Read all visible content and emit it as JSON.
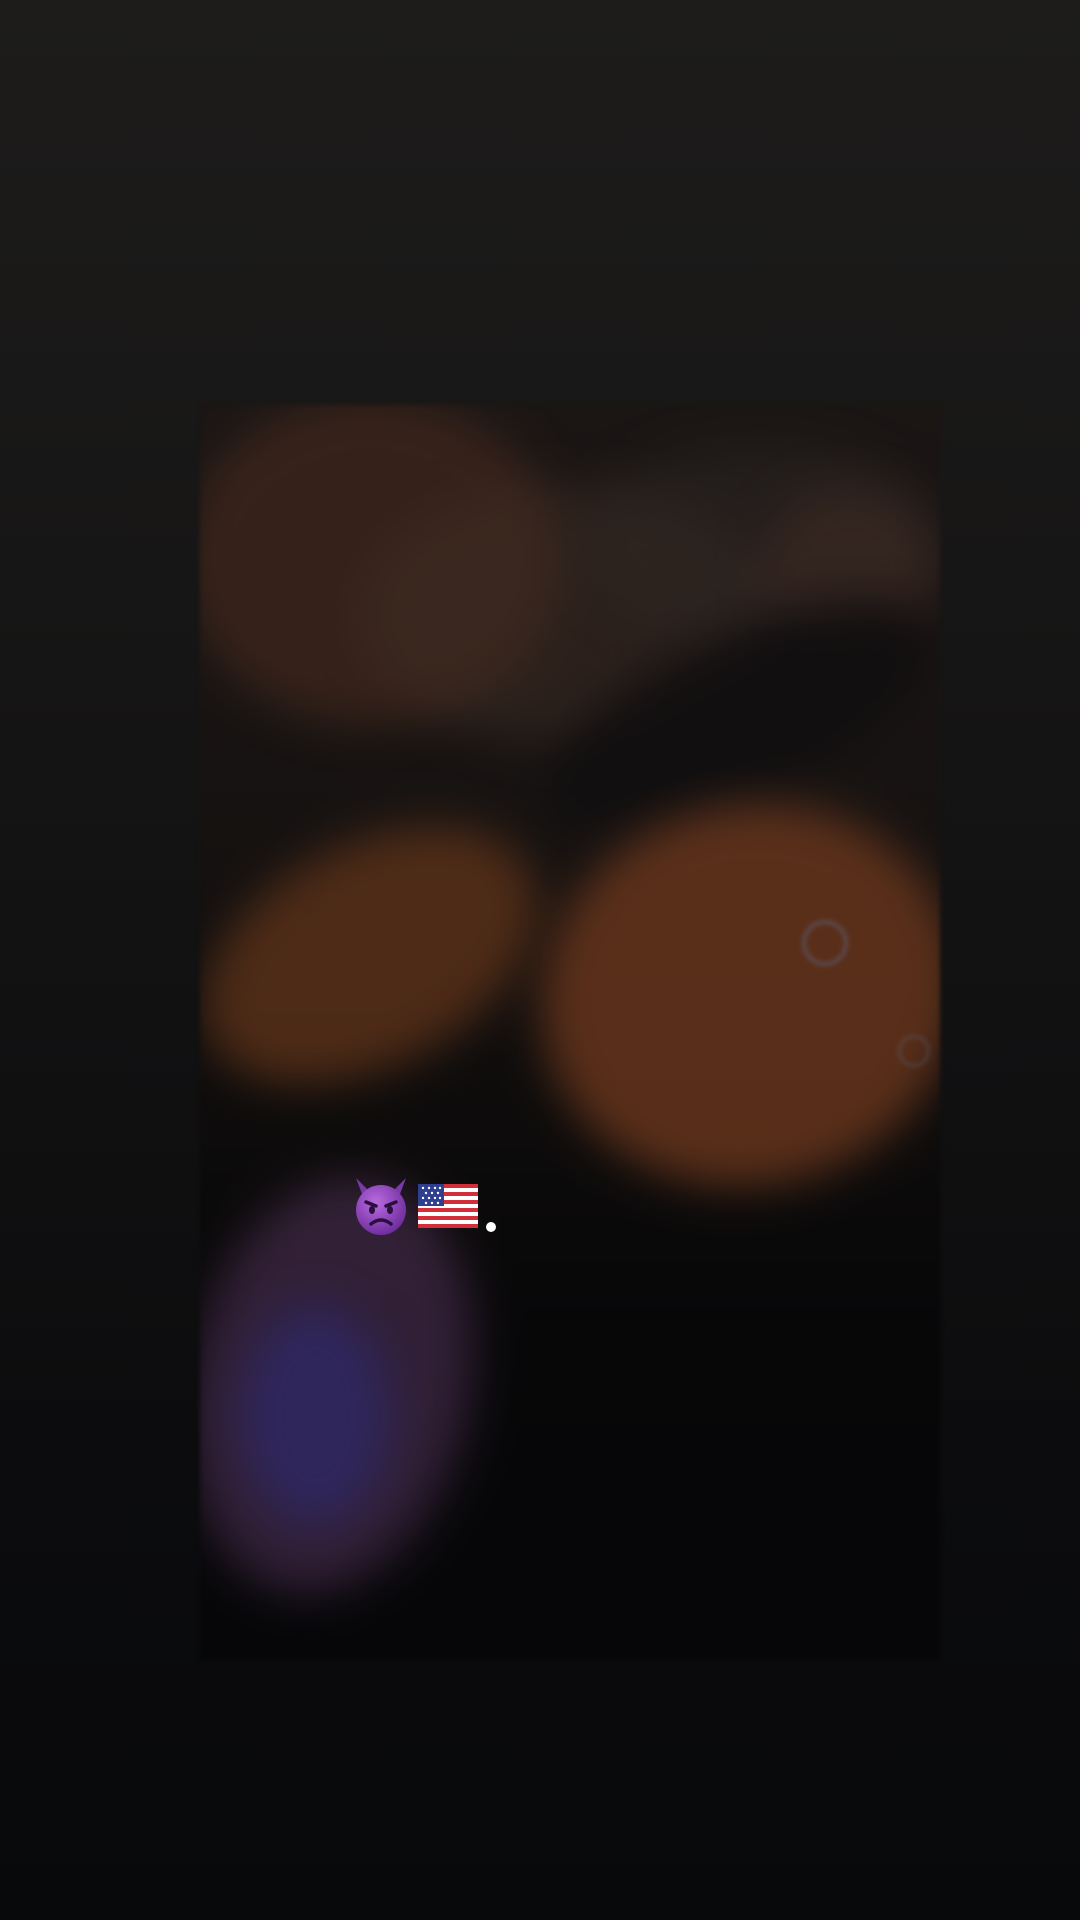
{
  "screen": {
    "background_color": "#0e0e0f"
  },
  "media": {
    "type": "blurred-video-frame",
    "tint": "dark"
  },
  "caption": {
    "icons": [
      "smiling-face-with-horns-emoji",
      "us-flag-emoji"
    ],
    "trailing_dot_color": "#ffffff"
  }
}
